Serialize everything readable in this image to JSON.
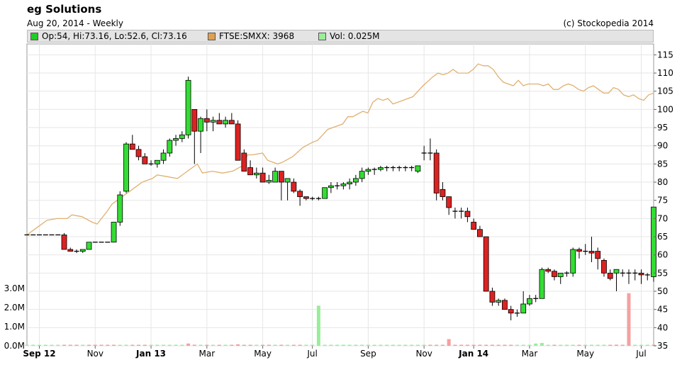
{
  "header": {
    "title": "eg Solutions",
    "subtitle": "Aug 20, 2014 - Weekly",
    "credit": "(c) Stockopedia 2014"
  },
  "legend": [
    {
      "label": "Op:54, Hi:73.16, Lo:52.6, Cl:73.16",
      "color": "#22cc22"
    },
    {
      "label": "FTSE:SMXX: 3968",
      "color": "#e0a050"
    },
    {
      "label": "Vol: 0.025M",
      "color": "#99ee99"
    }
  ],
  "chart_data": {
    "type": "candlestick",
    "colors": {
      "up": "#33dd33",
      "down": "#dd2222",
      "ftse_line": "#e0b070",
      "vol_up": "#99ee99",
      "vol_down": "#f4a0a0"
    },
    "y_axis_right": {
      "ticks": [
        35,
        40,
        45,
        50,
        55,
        60,
        65,
        70,
        75,
        80,
        85,
        90,
        95,
        100,
        105,
        110,
        115
      ],
      "range": [
        35,
        118
      ]
    },
    "y_axis_left_volume": {
      "ticks": [
        "0.0M",
        "1.0M",
        "2.0M",
        "3.0M"
      ],
      "values": [
        0,
        1,
        2,
        3
      ]
    },
    "x_axis": {
      "labels": [
        {
          "label": "Sep 12",
          "week": 2,
          "bold": true
        },
        {
          "label": "Nov",
          "week": 11,
          "bold": false
        },
        {
          "label": "Jan 13",
          "week": 20,
          "bold": true
        },
        {
          "label": "Mar",
          "week": 29,
          "bold": false
        },
        {
          "label": "May",
          "week": 38,
          "bold": false
        },
        {
          "label": "Jul",
          "week": 46,
          "bold": false
        },
        {
          "label": "Sep",
          "week": 55,
          "bold": false
        },
        {
          "label": "Nov",
          "week": 64,
          "bold": false
        },
        {
          "label": "Jan 14",
          "week": 72,
          "bold": true
        },
        {
          "label": "Mar",
          "week": 81,
          "bold": false
        },
        {
          "label": "May",
          "week": 90,
          "bold": false
        },
        {
          "label": "Jul",
          "week": 99,
          "bold": false
        }
      ]
    },
    "candles": [
      [
        65.5,
        65.5,
        65.5,
        65.5
      ],
      [
        65.5,
        65.5,
        65.5,
        65.5
      ],
      [
        65.5,
        65.5,
        65.5,
        65.5
      ],
      [
        65.5,
        65.5,
        65.5,
        65.5
      ],
      [
        65.5,
        65.5,
        65.5,
        65.5
      ],
      [
        65.5,
        65.5,
        65.5,
        65.5
      ],
      [
        65.5,
        66,
        61.5,
        61.5
      ],
      [
        61.5,
        62,
        61,
        61
      ],
      [
        61,
        61.5,
        60.5,
        61
      ],
      [
        61,
        61.5,
        60.5,
        61.5
      ],
      [
        61.5,
        63.5,
        61.5,
        63.5
      ],
      [
        63.5,
        63.5,
        63.5,
        63.5
      ],
      [
        63.5,
        63.5,
        63.5,
        63.5
      ],
      [
        63.5,
        63.5,
        63.5,
        63.5
      ],
      [
        63.5,
        69,
        63.5,
        69
      ],
      [
        69,
        77.5,
        68,
        76.5
      ],
      [
        77.5,
        91,
        77,
        90.5
      ],
      [
        90.5,
        93,
        89,
        89
      ],
      [
        89,
        90,
        86,
        87
      ],
      [
        87,
        88,
        85,
        85
      ],
      [
        85,
        86,
        84.5,
        85
      ],
      [
        85,
        86,
        84,
        86
      ],
      [
        86,
        89,
        85,
        88
      ],
      [
        88,
        92,
        87,
        91.5
      ],
      [
        91.5,
        93,
        90,
        92
      ],
      [
        92,
        94,
        91,
        93
      ],
      [
        93,
        109,
        92,
        108
      ],
      [
        100,
        100,
        85,
        94
      ],
      [
        94,
        98,
        88,
        97.5
      ],
      [
        97.5,
        100,
        94,
        96.5
      ],
      [
        96.5,
        98,
        94,
        97
      ],
      [
        97,
        99,
        96,
        96
      ],
      [
        96,
        98,
        95,
        97
      ],
      [
        97,
        99,
        96,
        96
      ],
      [
        96,
        97,
        86,
        86
      ],
      [
        88,
        89,
        83,
        83
      ],
      [
        84,
        86,
        82,
        82
      ],
      [
        82,
        84,
        81,
        82.5
      ],
      [
        82.5,
        84,
        80,
        80
      ],
      [
        80,
        82,
        79.5,
        80.5
      ],
      [
        80,
        84,
        80,
        83
      ],
      [
        83,
        83,
        75,
        80
      ],
      [
        80,
        81,
        75,
        81
      ],
      [
        80,
        81,
        77,
        77.5
      ],
      [
        77.5,
        78,
        73.5,
        76
      ],
      [
        76,
        76,
        75,
        75.5
      ],
      [
        75.5,
        76,
        75,
        75.5
      ],
      [
        75.5,
        76,
        75,
        75.5
      ],
      [
        75.5,
        78.5,
        75.5,
        78.5
      ],
      [
        78.5,
        80,
        77,
        79
      ],
      [
        79,
        80,
        78,
        79
      ],
      [
        79,
        80,
        78,
        79.5
      ],
      [
        79.5,
        81,
        78,
        80
      ],
      [
        80,
        82,
        79,
        81
      ],
      [
        81,
        84,
        80,
        83
      ],
      [
        83,
        84,
        82,
        83.5
      ],
      [
        83.5,
        84,
        82,
        83.5
      ],
      [
        83.5,
        84.5,
        83,
        84
      ],
      [
        84,
        84.5,
        83,
        84
      ],
      [
        84,
        84.5,
        83,
        84
      ],
      [
        84,
        84.5,
        83,
        84
      ],
      [
        84,
        84.5,
        83,
        84
      ],
      [
        84,
        84.5,
        83,
        84
      ],
      [
        83,
        84.5,
        82.5,
        84.5
      ],
      [
        88,
        90,
        86,
        88
      ],
      [
        88,
        92,
        86,
        88
      ],
      [
        88,
        89,
        75,
        77
      ],
      [
        78,
        80,
        75,
        76
      ],
      [
        76,
        76,
        71,
        73
      ],
      [
        72,
        73,
        70,
        72
      ],
      [
        72,
        73,
        70,
        72
      ],
      [
        72,
        73,
        69,
        70.5
      ],
      [
        69,
        70,
        67,
        67
      ],
      [
        67,
        68,
        65,
        65
      ],
      [
        65,
        65,
        50,
        50
      ],
      [
        50,
        51,
        46,
        47
      ],
      [
        47,
        48,
        46,
        47.5
      ],
      [
        47.5,
        48,
        45,
        45
      ],
      [
        45,
        46,
        42,
        44
      ],
      [
        44,
        45,
        43,
        44
      ],
      [
        44,
        50,
        44,
        46.5
      ],
      [
        46.5,
        49,
        46,
        48
      ],
      [
        48,
        49,
        47,
        48
      ],
      [
        48,
        56.5,
        48,
        56
      ],
      [
        56,
        56.5,
        55,
        55.5
      ],
      [
        55.5,
        56,
        53,
        54
      ],
      [
        54,
        55,
        52,
        55
      ],
      [
        55,
        55.5,
        54,
        55
      ],
      [
        55,
        62,
        54,
        61.5
      ],
      [
        61.5,
        62,
        59,
        61
      ],
      [
        61,
        63,
        60,
        61
      ],
      [
        61,
        65,
        58,
        60.5
      ],
      [
        61,
        62,
        56,
        59
      ],
      [
        58.5,
        59,
        54,
        55
      ],
      [
        55,
        56,
        53,
        53.5
      ],
      [
        55,
        56,
        50,
        56
      ],
      [
        55,
        56,
        54,
        55
      ],
      [
        55,
        56,
        52,
        55
      ],
      [
        55,
        56,
        53,
        55
      ],
      [
        55,
        56,
        52,
        54.5
      ],
      [
        54.5,
        55,
        53,
        54.5
      ],
      [
        54,
        73.16,
        52.6,
        73.16
      ]
    ],
    "volume": [
      [
        0.02,
        1
      ],
      [
        0.01,
        1
      ],
      [
        0.01,
        1
      ],
      [
        0.01,
        1
      ],
      [
        0.01,
        1
      ],
      [
        0.01,
        1
      ],
      [
        0.02,
        0
      ],
      [
        0.02,
        0
      ],
      [
        0.03,
        0
      ],
      [
        0.05,
        1
      ],
      [
        0.01,
        0
      ],
      [
        0.01,
        0
      ],
      [
        0.01,
        0
      ],
      [
        0.01,
        0
      ],
      [
        0.01,
        0
      ],
      [
        0.02,
        1
      ],
      [
        0.03,
        1
      ],
      [
        0.02,
        0
      ],
      [
        0.02,
        0
      ],
      [
        0.03,
        0
      ],
      [
        0.02,
        1
      ],
      [
        0.01,
        1
      ],
      [
        0.03,
        1
      ],
      [
        0.04,
        1
      ],
      [
        0.05,
        1
      ],
      [
        0.04,
        1
      ],
      [
        0.12,
        0
      ],
      [
        0.06,
        0
      ],
      [
        0.04,
        1
      ],
      [
        0.03,
        0
      ],
      [
        0.03,
        1
      ],
      [
        0.05,
        0
      ],
      [
        0.02,
        1
      ],
      [
        0.03,
        0
      ],
      [
        0.08,
        0
      ],
      [
        0.02,
        0
      ],
      [
        0.02,
        0
      ],
      [
        0.02,
        1
      ],
      [
        0.02,
        0
      ],
      [
        0.02,
        0
      ],
      [
        0.03,
        1
      ],
      [
        0.02,
        0
      ],
      [
        0.02,
        1
      ],
      [
        0.02,
        0
      ],
      [
        0.02,
        0
      ],
      [
        0.02,
        1
      ],
      [
        0.02,
        1
      ],
      [
        2.1,
        1
      ],
      [
        0.02,
        1
      ],
      [
        0.02,
        1
      ],
      [
        0.02,
        1
      ],
      [
        0.02,
        1
      ],
      [
        0.02,
        1
      ],
      [
        0.02,
        1
      ],
      [
        0.02,
        1
      ],
      [
        0.02,
        1
      ],
      [
        0.02,
        1
      ],
      [
        0.02,
        1
      ],
      [
        0.02,
        1
      ],
      [
        0.02,
        1
      ],
      [
        0.02,
        1
      ],
      [
        0.02,
        1
      ],
      [
        0.02,
        1
      ],
      [
        0.02,
        1
      ],
      [
        0.02,
        1
      ],
      [
        0.02,
        0
      ],
      [
        0.02,
        0
      ],
      [
        0.02,
        0
      ],
      [
        0.35,
        0
      ],
      [
        0.02,
        0
      ],
      [
        0.02,
        0
      ],
      [
        0.04,
        0
      ],
      [
        0.03,
        0
      ],
      [
        0.03,
        0
      ],
      [
        0.03,
        0
      ],
      [
        0.05,
        0
      ],
      [
        0.03,
        0
      ],
      [
        0.05,
        0
      ],
      [
        0.04,
        0
      ],
      [
        0.03,
        1
      ],
      [
        0.03,
        1
      ],
      [
        0.05,
        1
      ],
      [
        0.12,
        1
      ],
      [
        0.15,
        1
      ],
      [
        0.03,
        1
      ],
      [
        0.02,
        0
      ],
      [
        0.02,
        1
      ],
      [
        0.03,
        1
      ],
      [
        0.04,
        1
      ],
      [
        0.03,
        0
      ],
      [
        0.02,
        1
      ],
      [
        0.02,
        1
      ],
      [
        0.02,
        1
      ],
      [
        0.02,
        1
      ],
      [
        0.02,
        0
      ],
      [
        0.06,
        0
      ],
      [
        0.02,
        0
      ],
      [
        2.75,
        0
      ],
      [
        0.02,
        1
      ],
      [
        0.02,
        1
      ],
      [
        0.02,
        1
      ],
      [
        0.02,
        0
      ],
      [
        0.04,
        1
      ],
      [
        0.025,
        1
      ]
    ],
    "ftse": [
      [
        0,
        65.5
      ],
      [
        2,
        67.5
      ],
      [
        4,
        69.5
      ],
      [
        6,
        70
      ],
      [
        8,
        70
      ],
      [
        9,
        71
      ],
      [
        11,
        70.5
      ],
      [
        13,
        69
      ],
      [
        14,
        68.5
      ],
      [
        16,
        72
      ],
      [
        17,
        74
      ],
      [
        19,
        76
      ],
      [
        21,
        78
      ],
      [
        23,
        80
      ],
      [
        25,
        81
      ],
      [
        26,
        82
      ],
      [
        28,
        81.5
      ],
      [
        30,
        81
      ],
      [
        32,
        83
      ],
      [
        34,
        85
      ],
      [
        35,
        82.5
      ],
      [
        37,
        83
      ],
      [
        39,
        82.5
      ],
      [
        41,
        83
      ],
      [
        43,
        84.5
      ],
      [
        44,
        87.5
      ],
      [
        45,
        87.5
      ],
      [
        47,
        88
      ],
      [
        48,
        86
      ],
      [
        50,
        85
      ],
      [
        51,
        85.5
      ],
      [
        53,
        87
      ],
      [
        55,
        89.5
      ],
      [
        57,
        91
      ],
      [
        58,
        91.5
      ],
      [
        60,
        94.5
      ],
      [
        61,
        95
      ],
      [
        63,
        96
      ],
      [
        64,
        98
      ],
      [
        65,
        98
      ],
      [
        67,
        99.5
      ],
      [
        68,
        99
      ],
      [
        69,
        102
      ],
      [
        70,
        103
      ],
      [
        71,
        102.5
      ],
      [
        72,
        103
      ],
      [
        73,
        101.5
      ],
      [
        75,
        102.5
      ],
      [
        77,
        103.5
      ],
      [
        78,
        105
      ],
      [
        79,
        106.5
      ],
      [
        81,
        109
      ],
      [
        82,
        110
      ],
      [
        83,
        109.5
      ],
      [
        84,
        110
      ],
      [
        85,
        111
      ],
      [
        86,
        110
      ],
      [
        87,
        110
      ],
      [
        88,
        110
      ],
      [
        89,
        111
      ],
      [
        90,
        112.5
      ],
      [
        91,
        112
      ],
      [
        92,
        112
      ],
      [
        93,
        111
      ],
      [
        94,
        109
      ],
      [
        95,
        107.5
      ],
      [
        96,
        107
      ],
      [
        97,
        106.5
      ],
      [
        98,
        108
      ],
      [
        99,
        106.5
      ],
      [
        100,
        107
      ],
      [
        101,
        107
      ],
      [
        102,
        107
      ],
      [
        103,
        106.5
      ],
      [
        104,
        107
      ],
      [
        105,
        105.5
      ],
      [
        106,
        105.5
      ],
      [
        107,
        106.5
      ],
      [
        108,
        107
      ],
      [
        109,
        106.5
      ],
      [
        110,
        105.5
      ],
      [
        111,
        105
      ],
      [
        112,
        106
      ],
      [
        113,
        106.5
      ],
      [
        114,
        105.5
      ],
      [
        115,
        104.5
      ],
      [
        116,
        104.5
      ],
      [
        117,
        106
      ],
      [
        118,
        105.5
      ],
      [
        119,
        104
      ],
      [
        120,
        103.5
      ],
      [
        121,
        104
      ],
      [
        122,
        103
      ],
      [
        123,
        102.5
      ],
      [
        124,
        104
      ],
      [
        125,
        104.5
      ]
    ]
  }
}
